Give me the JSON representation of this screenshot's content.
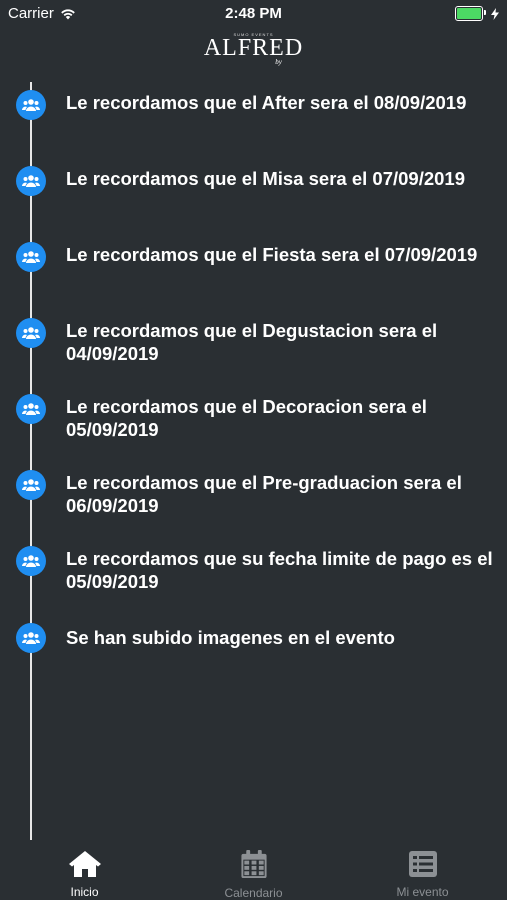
{
  "status_bar": {
    "carrier": "Carrier",
    "time": "2:48 PM"
  },
  "logo": {
    "tagline": "SUMO EVENTS",
    "name": "ALFRED",
    "sub": "by"
  },
  "notifications": [
    {
      "text": "Le recordamos que el After sera el 08/09/2019",
      "icon": "group-icon"
    },
    {
      "text": "Le recordamos que el Misa sera el 07/09/2019",
      "icon": "group-icon"
    },
    {
      "text": "Le recordamos que el Fiesta sera el 07/09/2019",
      "icon": "group-icon"
    },
    {
      "text": "Le recordamos que el Degustacion sera el 04/09/2019",
      "icon": "group-icon"
    },
    {
      "text": "Le recordamos que el Decoracion sera el 05/09/2019",
      "icon": "group-icon"
    },
    {
      "text": "Le recordamos que el Pre-graduacion sera el 06/09/2019",
      "icon": "group-icon"
    },
    {
      "text": "Le recordamos que su fecha limite de pago es el 05/09/2019",
      "icon": "group-icon"
    },
    {
      "text": "Se han subido imagenes en el evento",
      "icon": "group-icon"
    }
  ],
  "tabs": [
    {
      "label": "Inicio",
      "icon": "home-icon",
      "active": true
    },
    {
      "label": "Calendario",
      "icon": "calendar-icon",
      "active": false
    },
    {
      "label": "Mi evento",
      "icon": "list-icon",
      "active": false
    }
  ],
  "colors": {
    "background": "#2a2f33",
    "accent": "#1f8ef1",
    "battery": "#4cd964",
    "inactive_tab": "#8c9094"
  }
}
